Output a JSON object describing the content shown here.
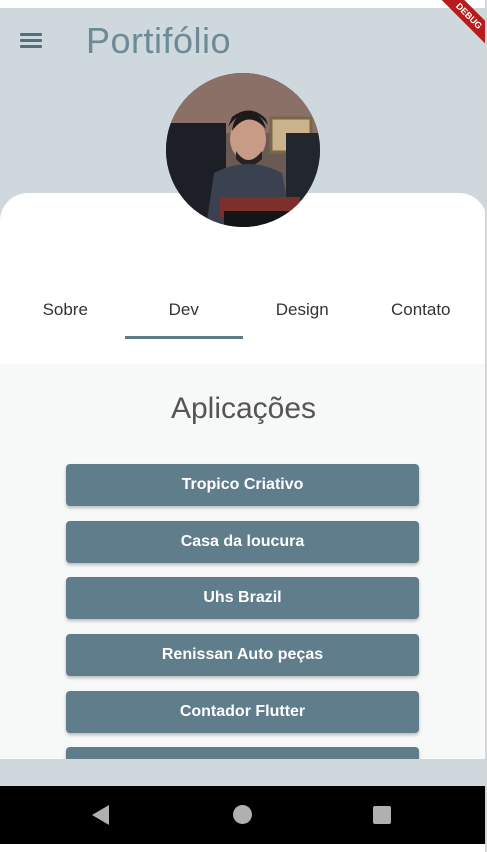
{
  "appbar": {
    "title": "Portifólio",
    "debug_label": "DEBUG"
  },
  "tabs": [
    {
      "label": "Sobre"
    },
    {
      "label": "Dev"
    },
    {
      "label": "Design"
    },
    {
      "label": "Contato"
    }
  ],
  "active_tab": "Dev",
  "section": {
    "title": "Aplicações",
    "buttons": [
      {
        "label": "Tropico Criativo"
      },
      {
        "label": "Casa da loucura"
      },
      {
        "label": "Uhs Brazil"
      },
      {
        "label": "Renissan Auto peças"
      },
      {
        "label": "Contador Flutter"
      }
    ]
  },
  "colors": {
    "appbar_bg": "#cfd8dc",
    "accent": "#607d8b",
    "title": "#6d8a97"
  },
  "icons": {
    "menu": "hamburger-menu-icon",
    "nav_back": "triangle-back-icon",
    "nav_home": "circle-home-icon",
    "nav_recent": "square-recent-icon"
  }
}
